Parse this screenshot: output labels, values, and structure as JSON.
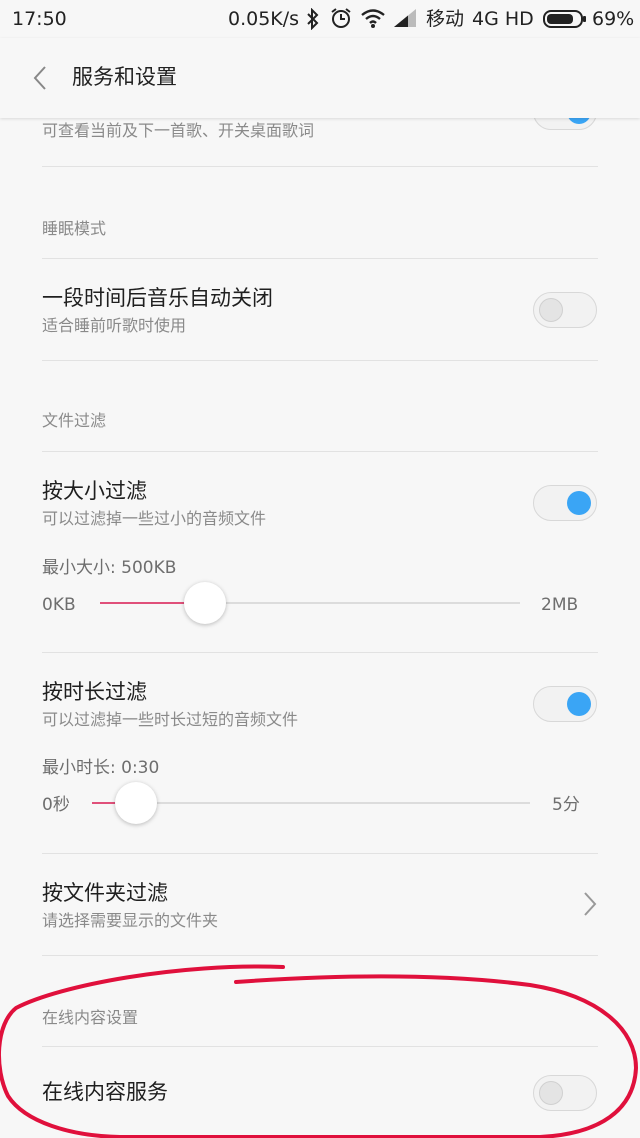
{
  "status_bar": {
    "time": "17:50",
    "speed": "0.05K/s",
    "carrier": "移动",
    "network": "4G HD",
    "battery": "69%"
  },
  "header": {
    "title": "服务和设置"
  },
  "items": {
    "lyrics": {
      "subtitle": "可查看当前及下一首歌、开关桌面歌词",
      "toggle_on": true
    },
    "sleep_section": "睡眠模式",
    "sleep": {
      "title": "一段时间后音乐自动关闭",
      "subtitle": "适合睡前听歌时使用",
      "toggle_on": false
    },
    "filter_section": "文件过滤",
    "size_filter": {
      "title": "按大小过滤",
      "subtitle": "可以过滤掉一些过小的音频文件",
      "toggle_on": true,
      "slider_label": "最小大小: 500KB",
      "min_label": "0KB",
      "max_label": "2MB",
      "value_fraction": 0.25
    },
    "duration_filter": {
      "title": "按时长过滤",
      "subtitle": "可以过滤掉一些时长过短的音频文件",
      "toggle_on": true,
      "slider_label": "最小时长: 0:30",
      "min_label": "0秒",
      "max_label": "5分",
      "value_fraction": 0.1
    },
    "folder_filter": {
      "title": "按文件夹过滤",
      "subtitle": "请选择需要显示的文件夹"
    },
    "online_section": "在线内容设置",
    "online": {
      "title": "在线内容服务",
      "toggle_on": false
    }
  },
  "colors": {
    "accent": "#3aa5f5",
    "slider_fill": "#e0507a",
    "annotation": "#e0103c"
  }
}
